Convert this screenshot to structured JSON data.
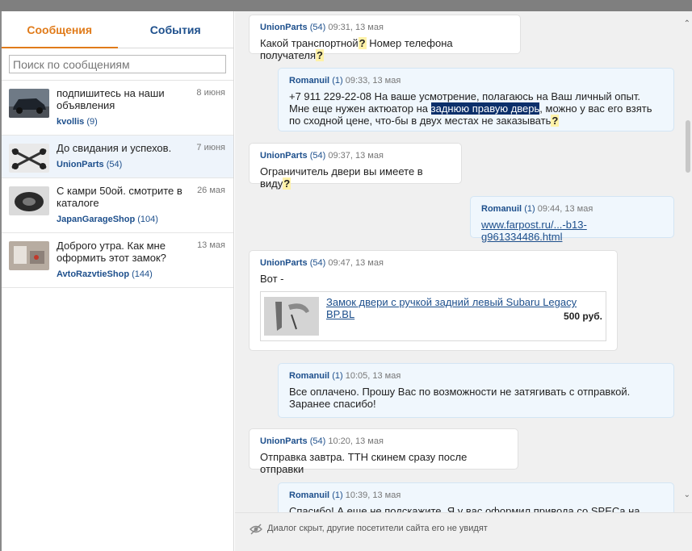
{
  "tabs": {
    "messages": "Сообщения",
    "events": "События"
  },
  "search": {
    "placeholder": "Поиск по сообщениям"
  },
  "conversations": [
    {
      "text": "подпишитесь на наши объявления",
      "date": "8 июня",
      "sender": "kvollis",
      "count": "(9)"
    },
    {
      "text": "До свидания и успехов.",
      "date": "7 июня",
      "sender": "UnionParts",
      "count": "(54)"
    },
    {
      "text": "С камри 50ой. смотрите в каталоге",
      "date": "26 мая",
      "sender": "JapanGarageShop",
      "count": "(104)"
    },
    {
      "text": "Доброго утра. Как мне оформить этот замок?",
      "date": "13 мая",
      "sender": "AvtoRazvtieShop",
      "count": "(144)"
    }
  ],
  "messages": [
    {
      "name": "UnionParts",
      "count": "(54)",
      "time": "09:31, 13 мая",
      "text": "Какой транспортной",
      "q1": "?",
      "text2": " Номер телефона получателя",
      "q2": "?"
    },
    {
      "name": "Romanuil",
      "count": "(1)",
      "time": "09:33, 13 мая",
      "text_a": "+7 911 229-22-08 На ваше усмотрение, полагаюсь на Ваш личный опыт. Мне еще нужен актюатор на ",
      "selected": "заднюю правую дверь",
      "text_b": ", можно у вас его взять по сходной цене, что-бы в двух местах не заказывать",
      "q": "?"
    },
    {
      "name": "UnionParts",
      "count": "(54)",
      "time": "09:37, 13 мая",
      "text": "Ограничитель двери вы имеете в виду",
      "q": "?"
    },
    {
      "name": "Romanuil",
      "count": "(1)",
      "time": "09:44, 13 мая",
      "link": "www.farpost.ru/...-b13-g961334486.html"
    },
    {
      "name": "UnionParts",
      "count": "(54)",
      "time": "09:47, 13 мая",
      "text": "Вот -",
      "product_title": "Замок двери с ручкой задний левый Subaru Legacy BP.BL",
      "product_price": "500 руб."
    },
    {
      "name": "Romanuil",
      "count": "(1)",
      "time": "10:05, 13 мая",
      "text": "Все оплачено. Прошу Вас по возможности не затягивать с отправкой. Заранее спасибо!"
    },
    {
      "name": "UnionParts",
      "count": "(54)",
      "time": "10:20, 13 мая",
      "text": "Отправка завтра. ТТН скинем сразу после отправки"
    },
    {
      "name": "Romanuil",
      "count": "(1)",
      "time": "10:39, 13 мая",
      "text": "Спасибо! А еще не подскажите. Я у вас оформил привода со SPECа на"
    }
  ],
  "footer": {
    "text": "Диалог скрыт, другие посетители сайта его не увидят",
    "icon": "eye-icon"
  },
  "colors": {
    "accent": "#e07b1a",
    "link": "#1d4f8c",
    "outgoing_bg": "#f0f7fd",
    "selection": "#0b2f6a"
  }
}
